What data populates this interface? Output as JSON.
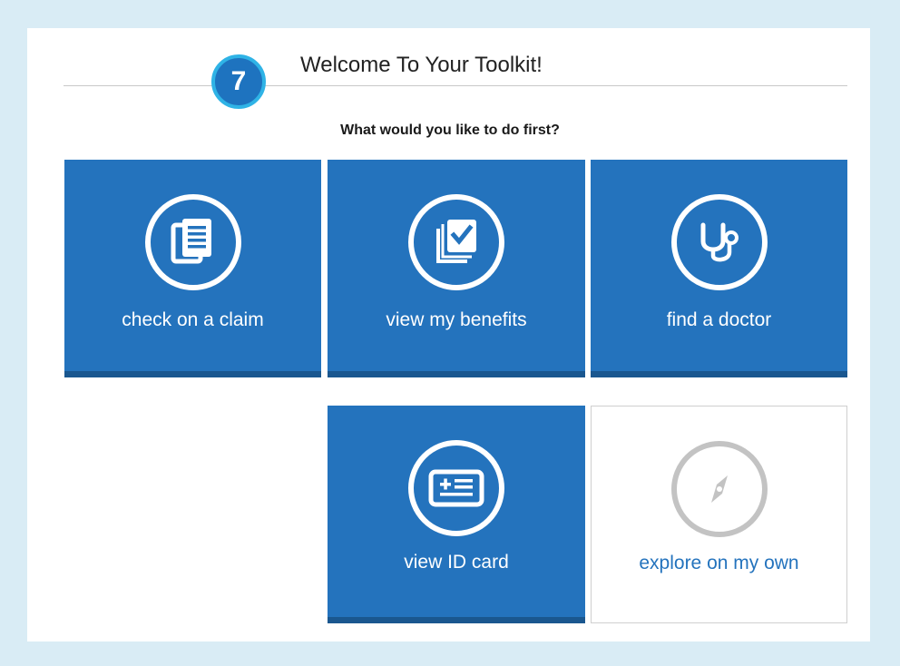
{
  "badge": "7",
  "title": "Welcome To Your Toolkit!",
  "question": "What would you like to do first?",
  "tiles": {
    "claim": {
      "label": "check on a claim",
      "icon": "document-stack-icon"
    },
    "benefits": {
      "label": "view my benefits",
      "icon": "checkbook-icon"
    },
    "doctor": {
      "label": "find a doctor",
      "icon": "stethoscope-icon"
    },
    "idcard": {
      "label": "view ID card",
      "icon": "id-card-icon"
    },
    "explore": {
      "label": "explore on my own",
      "icon": "compass-icon"
    }
  },
  "colors": {
    "background": "#d9ecf5",
    "tile_blue": "#2473bd",
    "tile_bottom": "#1a578f",
    "badge_fill": "#1e73bf",
    "badge_ring": "#2fb3e6",
    "explore_icon": "#c3c3c3"
  }
}
